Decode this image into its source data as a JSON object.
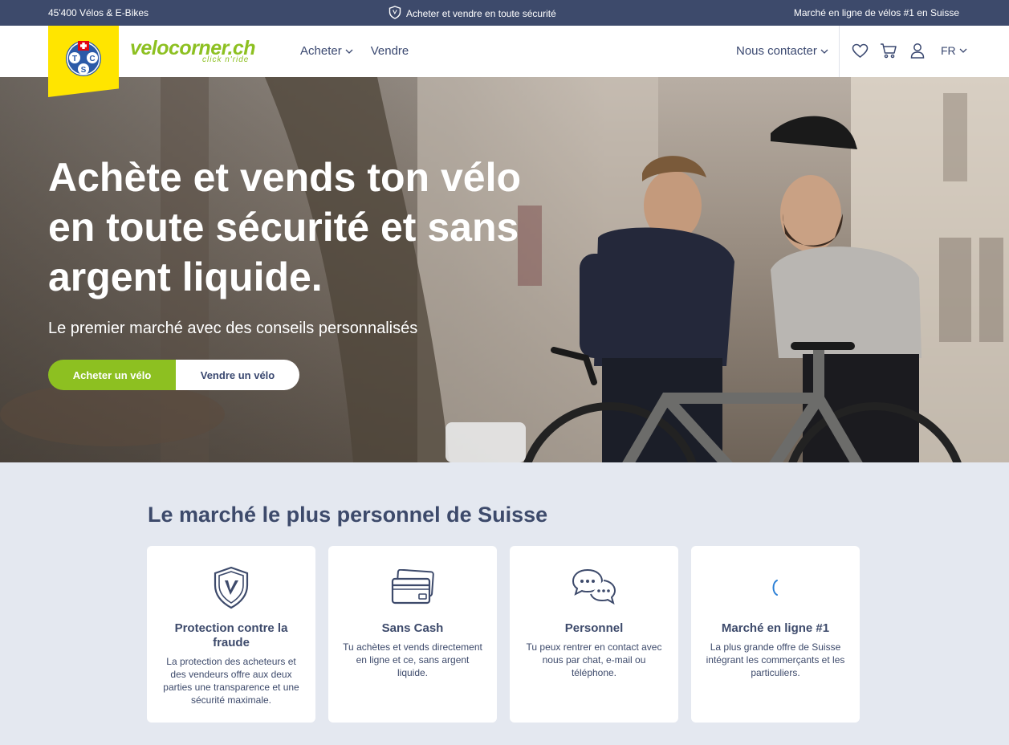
{
  "topbar": {
    "left_text": "45'400 Vélos & E-Bikes",
    "center_text": "Acheter et vendre en toute sécurité",
    "right_text": "Marché en ligne de vélos #1 en Suisse"
  },
  "header": {
    "logo_letters": [
      "T",
      "C",
      "S"
    ],
    "brand": "velocorner.ch",
    "brand_tagline": "click n'ride",
    "nav": [
      {
        "label": "Acheter"
      },
      {
        "label": "Vendre"
      }
    ],
    "contact_label": "Nous contacter",
    "language": "FR",
    "icons": [
      "heart-icon",
      "cart-icon",
      "user-icon"
    ]
  },
  "hero": {
    "title": "Achète et vends ton vélo en toute sécurité et sans argent liquide.",
    "subtitle": "Le premier marché avec des conseils personnalisés",
    "buy_button": "Acheter un vélo",
    "sell_button": "Vendre un vélo"
  },
  "features": {
    "title": "Le marché le plus personnel de Suisse",
    "cards": [
      {
        "icon": "shield-icon",
        "title": "Protection contre la fraude",
        "text": "La protection des acheteurs et des vendeurs offre aux deux parties une transparence et une sécurité maximale."
      },
      {
        "icon": "credit-card-icon",
        "title": "Sans Cash",
        "text": "Tu achètes et vends directement en ligne et ce, sans argent liquide."
      },
      {
        "icon": "chat-icon",
        "title": "Personnel",
        "text": "Tu peux rentrer en contact avec nous par chat, e-mail ou téléphone."
      },
      {
        "icon": "loading-icon",
        "title": "Marché en ligne #1",
        "text": "La plus grande offre de Suisse intégrant les commerçants et les particuliers."
      }
    ]
  },
  "colors": {
    "topbar": "#3d4a6b",
    "accent_green": "#8dc021",
    "tcs_yellow": "#ffe500",
    "text_navy": "#3a4870",
    "section_bg": "#e4e8f0"
  }
}
